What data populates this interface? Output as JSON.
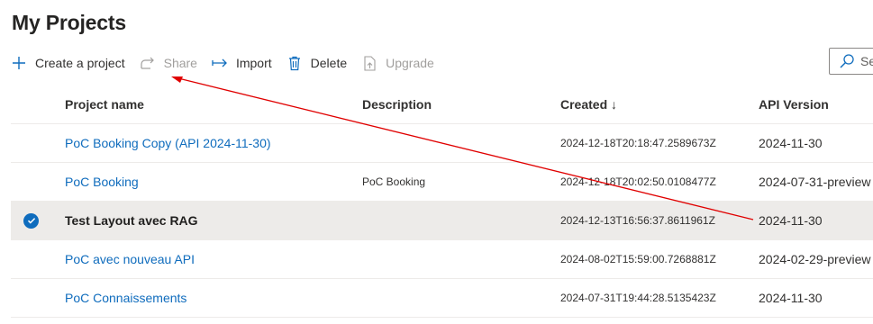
{
  "page": {
    "title": "My Projects"
  },
  "toolbar": {
    "create_label": "Create a project",
    "share_label": "Share",
    "import_label": "Import",
    "delete_label": "Delete",
    "upgrade_label": "Upgrade"
  },
  "search": {
    "text": "Se"
  },
  "table": {
    "headers": {
      "name": "Project name",
      "description": "Description",
      "created": "Created ↓",
      "api": "API Version"
    },
    "rows": [
      {
        "name": "PoC Booking Copy (API 2024-11-30)",
        "description": "",
        "created": "2024-12-18T20:18:47.2589673Z",
        "api": "2024-11-30",
        "selected": false
      },
      {
        "name": "PoC Booking",
        "description": "PoC Booking",
        "created": "2024-12-18T20:02:50.0108477Z",
        "api": "2024-07-31-preview",
        "selected": false
      },
      {
        "name": "Test Layout avec RAG",
        "description": "",
        "created": "2024-12-13T16:56:37.8611961Z",
        "api": "2024-11-30",
        "selected": true
      },
      {
        "name": "PoC avec nouveau API",
        "description": "",
        "created": "2024-08-02T15:59:00.7268881Z",
        "api": "2024-02-29-preview",
        "selected": false
      },
      {
        "name": "PoC Connaissements",
        "description": "",
        "created": "2024-07-31T19:44:28.5135423Z",
        "api": "2024-11-30",
        "selected": false
      }
    ]
  },
  "colors": {
    "link": "#0f6cbd",
    "annotation_arrow": "#e00000",
    "selected_row": "#edebe9"
  },
  "icons": {
    "create": "plus-icon",
    "share": "share-icon",
    "import": "import-arrow-icon",
    "delete": "trash-icon",
    "upgrade": "upgrade-icon",
    "search": "search-icon",
    "selected": "checkmark-circle-icon"
  }
}
